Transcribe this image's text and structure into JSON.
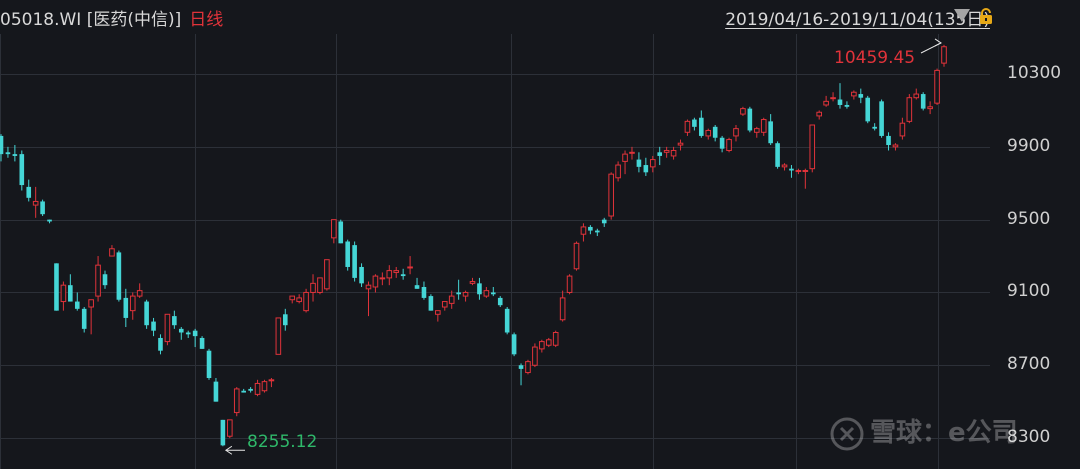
{
  "header": {
    "code_name": "05018.WI [医药(中信)]",
    "timeframe": "日线",
    "range": "2019/04/16-2019/11/04(135日)",
    "icons": [
      "dropdown-triangle-icon",
      "lock-icon"
    ],
    "colors": {
      "bg": "#15171c",
      "up": "#e0333a",
      "down": "#45d6d6",
      "low_label": "#2fb86a",
      "text": "#d8d8d8"
    }
  },
  "watermark": {
    "text": "雪球：e公司",
    "icon": "xueqiu-logo-icon"
  },
  "chart_data": {
    "type": "candlestick",
    "title": "",
    "xlabel": "",
    "ylabel": "",
    "ylim": [
      8130,
      10520
    ],
    "yticks": [
      "10300",
      "9900",
      "9500",
      "9100",
      "8700",
      "8300"
    ],
    "grid": true,
    "annotations": {
      "high": "10459.45",
      "low": "8255.12"
    },
    "candles": [
      [
        9960,
        9970,
        9820,
        9860
      ],
      [
        9870,
        9900,
        9840,
        9860
      ],
      [
        9860,
        9910,
        9820,
        9850
      ],
      [
        9860,
        9880,
        9660,
        9690
      ],
      [
        9680,
        9720,
        9600,
        9620
      ],
      [
        9580,
        9680,
        9510,
        9600
      ],
      [
        9600,
        9610,
        9520,
        9530
      ],
      [
        9500,
        9500,
        9480,
        9490
      ],
      [
        9260,
        9260,
        9000,
        9000
      ],
      [
        9050,
        9160,
        9000,
        9140
      ],
      [
        9140,
        9200,
        9050,
        9050
      ],
      [
        9050,
        9100,
        9000,
        9010
      ],
      [
        9010,
        9020,
        8880,
        8900
      ],
      [
        9020,
        9060,
        8870,
        9060
      ],
      [
        9080,
        9300,
        9050,
        9250
      ],
      [
        9200,
        9220,
        9120,
        9140
      ],
      [
        9300,
        9360,
        9300,
        9340
      ],
      [
        9320,
        9330,
        9050,
        9060
      ],
      [
        9070,
        9120,
        8910,
        8960
      ],
      [
        9000,
        9100,
        8950,
        9080
      ],
      [
        9080,
        9150,
        9070,
        9110
      ],
      [
        9050,
        9060,
        8900,
        8920
      ],
      [
        8940,
        8960,
        8860,
        8890
      ],
      [
        8850,
        8870,
        8760,
        8780
      ],
      [
        8830,
        8980,
        8810,
        8980
      ],
      [
        8970,
        9000,
        8900,
        8920
      ],
      [
        8900,
        8910,
        8840,
        8880
      ],
      [
        8880,
        8890,
        8850,
        8870
      ],
      [
        8890,
        8900,
        8800,
        8860
      ],
      [
        8850,
        8860,
        8790,
        8790
      ],
      [
        8780,
        8790,
        8620,
        8630
      ],
      [
        8610,
        8630,
        8500,
        8500
      ],
      [
        8400,
        8400,
        8255,
        8260
      ],
      [
        8310,
        8400,
        8300,
        8400
      ],
      [
        8440,
        8580,
        8420,
        8570
      ],
      [
        8560,
        8570,
        8550,
        8550
      ],
      [
        8570,
        8580,
        8550,
        8560
      ],
      [
        8540,
        8620,
        8530,
        8600
      ],
      [
        8560,
        8620,
        8550,
        8610
      ],
      [
        8620,
        8630,
        8580,
        8620
      ],
      [
        8760,
        8960,
        8760,
        8960
      ],
      [
        8980,
        9010,
        8890,
        8920
      ],
      [
        9060,
        9080,
        9040,
        9080
      ],
      [
        9050,
        9090,
        9040,
        9070
      ],
      [
        9000,
        9120,
        8990,
        9100
      ],
      [
        9100,
        9200,
        9050,
        9150
      ],
      [
        9100,
        9180,
        9090,
        9180
      ],
      [
        9120,
        9280,
        9110,
        9280
      ],
      [
        9400,
        9500,
        9370,
        9500
      ],
      [
        9490,
        9500,
        9370,
        9370
      ],
      [
        9380,
        9390,
        9220,
        9240
      ],
      [
        9360,
        9380,
        9160,
        9180
      ],
      [
        9240,
        9260,
        9130,
        9150
      ],
      [
        9120,
        9160,
        8970,
        9140
      ],
      [
        9130,
        9200,
        9100,
        9190
      ],
      [
        9180,
        9210,
        9140,
        9180
      ],
      [
        9180,
        9250,
        9140,
        9220
      ],
      [
        9210,
        9240,
        9180,
        9220
      ],
      [
        9200,
        9230,
        9170,
        9190
      ],
      [
        9240,
        9300,
        9200,
        9240
      ],
      [
        9140,
        9180,
        9120,
        9120
      ],
      [
        9130,
        9160,
        9060,
        9070
      ],
      [
        9080,
        9090,
        9000,
        9000
      ],
      [
        8980,
        8990,
        8940,
        9000
      ],
      [
        9020,
        9050,
        9000,
        9050
      ],
      [
        9040,
        9110,
        9010,
        9080
      ],
      [
        9100,
        9170,
        9060,
        9090
      ],
      [
        9080,
        9110,
        9050,
        9100
      ],
      [
        9150,
        9180,
        9140,
        9160
      ],
      [
        9150,
        9180,
        9060,
        9090
      ],
      [
        9080,
        9130,
        9070,
        9110
      ],
      [
        9100,
        9130,
        9080,
        9090
      ],
      [
        9070,
        9080,
        9020,
        9030
      ],
      [
        9010,
        9020,
        8870,
        8880
      ],
      [
        8870,
        8880,
        8750,
        8760
      ],
      [
        8700,
        8710,
        8590,
        8680
      ],
      [
        8660,
        8730,
        8650,
        8720
      ],
      [
        8700,
        8820,
        8690,
        8800
      ],
      [
        8790,
        8840,
        8770,
        8830
      ],
      [
        8810,
        8850,
        8800,
        8840
      ],
      [
        8810,
        8890,
        8800,
        8880
      ],
      [
        8950,
        9110,
        8940,
        9070
      ],
      [
        9100,
        9200,
        9090,
        9190
      ],
      [
        9230,
        9380,
        9220,
        9370
      ],
      [
        9420,
        9480,
        9380,
        9460
      ],
      [
        9460,
        9470,
        9420,
        9440
      ],
      [
        9440,
        9450,
        9410,
        9430
      ],
      [
        9500,
        9510,
        9460,
        9480
      ],
      [
        9520,
        9760,
        9500,
        9750
      ],
      [
        9730,
        9820,
        9710,
        9800
      ],
      [
        9820,
        9880,
        9750,
        9860
      ],
      [
        9870,
        9900,
        9830,
        9870
      ],
      [
        9830,
        9870,
        9760,
        9790
      ],
      [
        9800,
        9840,
        9740,
        9760
      ],
      [
        9790,
        9850,
        9760,
        9830
      ],
      [
        9870,
        9900,
        9800,
        9850
      ],
      [
        9870,
        9900,
        9840,
        9880
      ],
      [
        9850,
        9900,
        9830,
        9880
      ],
      [
        9910,
        9940,
        9880,
        9920
      ],
      [
        9980,
        10050,
        9960,
        10040
      ],
      [
        10050,
        10060,
        9990,
        10010
      ],
      [
        10060,
        10100,
        9950,
        9960
      ],
      [
        9960,
        10000,
        9940,
        9990
      ],
      [
        10010,
        10020,
        9930,
        9950
      ],
      [
        9950,
        9960,
        9870,
        9890
      ],
      [
        9880,
        9950,
        9870,
        9940
      ],
      [
        9960,
        10020,
        9930,
        10000
      ],
      [
        10080,
        10120,
        10070,
        10110
      ],
      [
        10110,
        10120,
        9980,
        9990
      ],
      [
        9980,
        10010,
        9950,
        10000
      ],
      [
        9980,
        10060,
        9960,
        10050
      ],
      [
        10040,
        10080,
        9910,
        9920
      ],
      [
        9920,
        9930,
        9780,
        9790
      ],
      [
        9790,
        9810,
        9770,
        9800
      ],
      [
        9780,
        9800,
        9730,
        9770
      ],
      [
        9770,
        9780,
        9750,
        9770
      ],
      [
        9770,
        9780,
        9670,
        9770
      ],
      [
        9780,
        10020,
        9760,
        10020
      ],
      [
        10070,
        10100,
        10050,
        10090
      ],
      [
        10130,
        10180,
        10120,
        10150
      ],
      [
        10170,
        10200,
        10150,
        10170
      ],
      [
        10160,
        10250,
        10110,
        10130
      ],
      [
        10130,
        10150,
        10110,
        10120
      ],
      [
        10180,
        10210,
        10160,
        10200
      ],
      [
        10190,
        10220,
        10140,
        10170
      ],
      [
        10170,
        10180,
        10030,
        10040
      ],
      [
        10010,
        10030,
        9990,
        10000
      ],
      [
        10150,
        10160,
        9950,
        9960
      ],
      [
        9960,
        9980,
        9880,
        9910
      ],
      [
        9900,
        9920,
        9880,
        9910
      ],
      [
        9960,
        10060,
        9940,
        10030
      ],
      [
        10040,
        10190,
        10030,
        10170
      ],
      [
        10170,
        10220,
        10160,
        10190
      ],
      [
        10190,
        10200,
        10100,
        10110
      ],
      [
        10110,
        10150,
        10080,
        10120
      ],
      [
        10140,
        10330,
        10130,
        10320
      ],
      [
        10360,
        10460,
        10340,
        10450
      ]
    ]
  }
}
